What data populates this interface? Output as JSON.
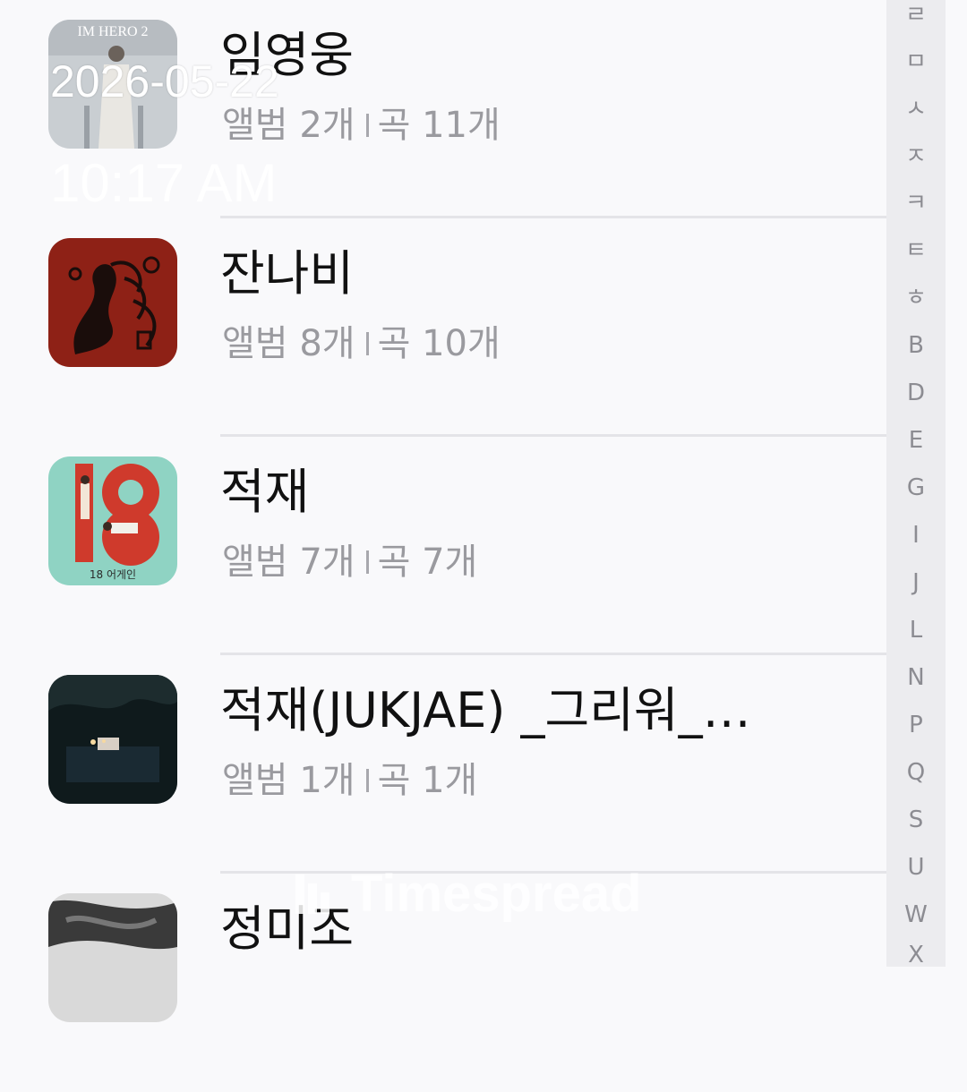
{
  "artists": [
    {
      "name": "임영웅",
      "albums_label": "앨범 2개",
      "songs_label": "곡 11개",
      "thumb": "album-art-im-hero-2",
      "thumb_text": "IM HERO 2"
    },
    {
      "name": "잔나비",
      "albums_label": "앨범 8개",
      "songs_label": "곡 10개",
      "thumb": "album-art-red-illustration"
    },
    {
      "name": "적재",
      "albums_label": "앨범 7개",
      "songs_label": "곡 7개",
      "thumb": "album-art-18-again",
      "thumb_text": "18 어게인"
    },
    {
      "name": "적재(JUKJAE) _그리워_…",
      "albums_label": "앨범 1개",
      "songs_label": "곡 1개",
      "thumb": "album-art-dark-night"
    },
    {
      "name": "정미조",
      "thumb": "album-art-bw-photo"
    }
  ],
  "index_bar": [
    "ㄹ",
    "ㅁ",
    "ㅅ",
    "ㅈ",
    "ㅋ",
    "ㅌ",
    "ㅎ",
    "B",
    "D",
    "E",
    "G",
    "I",
    "J",
    "L",
    "N",
    "P",
    "Q",
    "S",
    "U",
    "W",
    "X"
  ],
  "overlay": {
    "date": "2026-05-22",
    "time": "10:17 AM"
  },
  "watermark": "Timespread",
  "colors": {
    "background": "#f9f9fb",
    "secondary_text": "#9a9a9f",
    "index_bar_bg": "#ececef"
  }
}
